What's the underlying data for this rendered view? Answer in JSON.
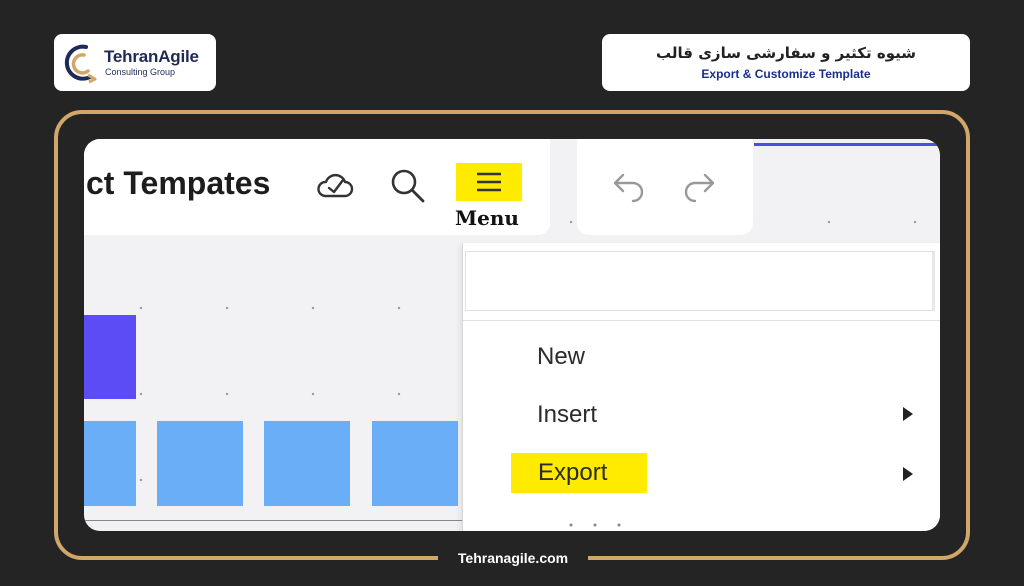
{
  "logo": {
    "name": "TehranAgile",
    "subtitle": "Consulting Group"
  },
  "header": {
    "title_fa": "شیوه تکثیر و سفارشی سازی قالب",
    "title_en": "Export & Customize Template"
  },
  "footer": {
    "site": "Tehranagile.com"
  },
  "app": {
    "board_title": "ct Tempates",
    "menu_caption": "Menu",
    "icons": [
      "cloud-check-icon",
      "search-icon",
      "hamburger-menu-icon",
      "undo-icon",
      "redo-icon"
    ],
    "menu": {
      "search_value": "",
      "items": [
        {
          "label": "New",
          "has_submenu": false
        },
        {
          "label": "Insert",
          "has_submenu": true
        },
        {
          "label": "Export",
          "has_submenu": true,
          "highlighted": true
        }
      ]
    }
  },
  "colors": {
    "highlight": "#ffeb00",
    "frame_border": "#d1a66a",
    "sticky_purple": "#5b4cf5",
    "sticky_blue": "#6aaef8",
    "brand_blue": "#1a2f8a"
  }
}
